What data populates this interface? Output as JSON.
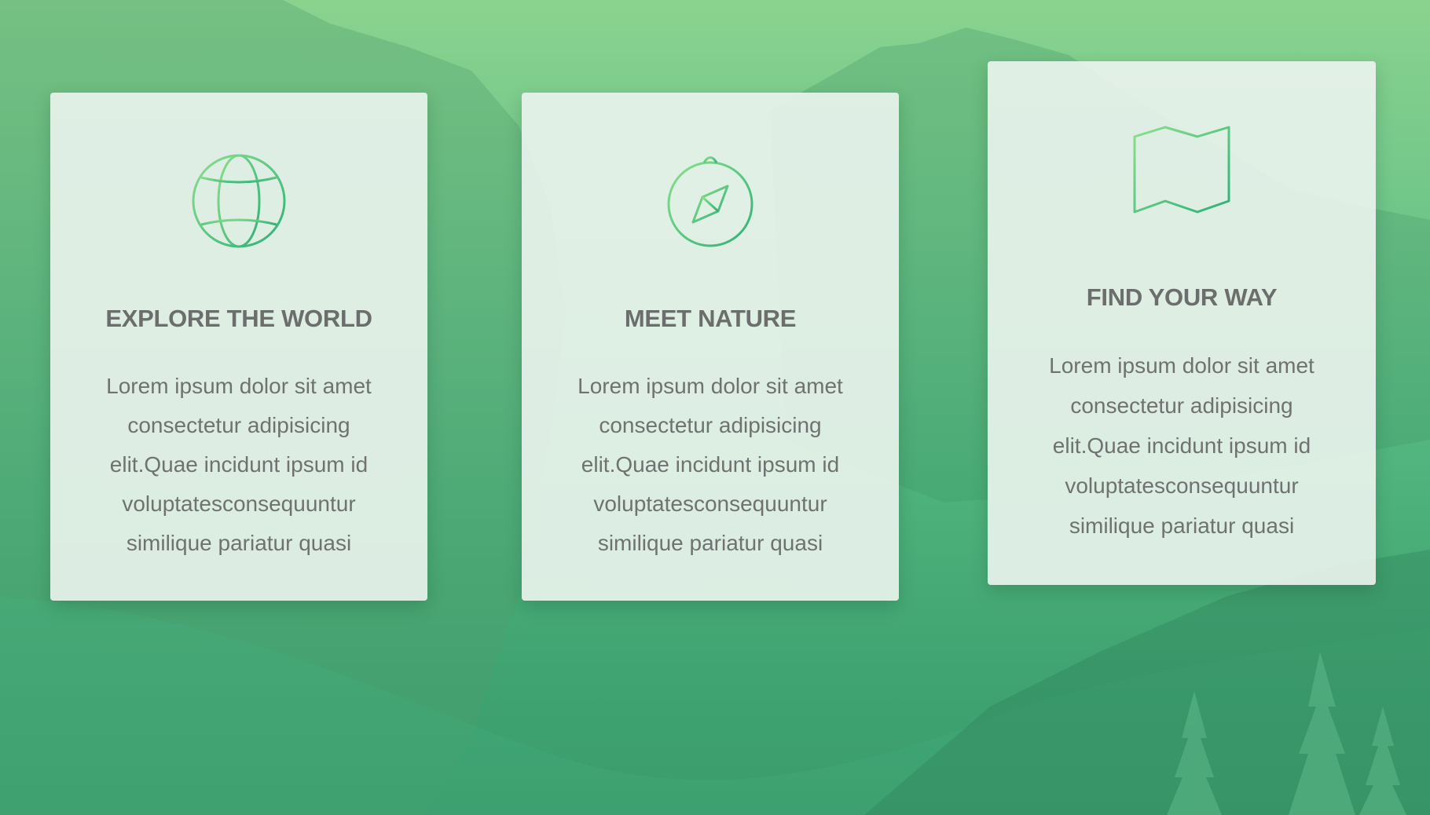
{
  "colors": {
    "background_top": "#8ad38f",
    "background_bottom": "#3b9c6b",
    "card_background": "#ecf4ee",
    "icon_start": "#8be08a",
    "icon_end": "#2fb07a",
    "title_text": "#6b6e6c",
    "body_text": "#6f7270"
  },
  "cards": [
    {
      "icon": "globe-icon",
      "title": "EXPLORE THE WORLD",
      "text": "Lorem ipsum dolor sit amet consectetur adipisicing elit.Quae incidunt ipsum id voluptatesconsequuntur similique pariatur quasi"
    },
    {
      "icon": "compass-icon",
      "title": "MEET NATURE",
      "text": "Lorem ipsum dolor sit amet consectetur adipisicing elit.Quae incidunt ipsum id voluptatesconsequuntur similique pariatur quasi"
    },
    {
      "icon": "map-icon",
      "title": "FIND YOUR WAY",
      "text": "Lorem ipsum dolor sit amet consectetur adipisicing elit.Quae incidunt ipsum id voluptatesconsequuntur similique pariatur quasi"
    }
  ]
}
